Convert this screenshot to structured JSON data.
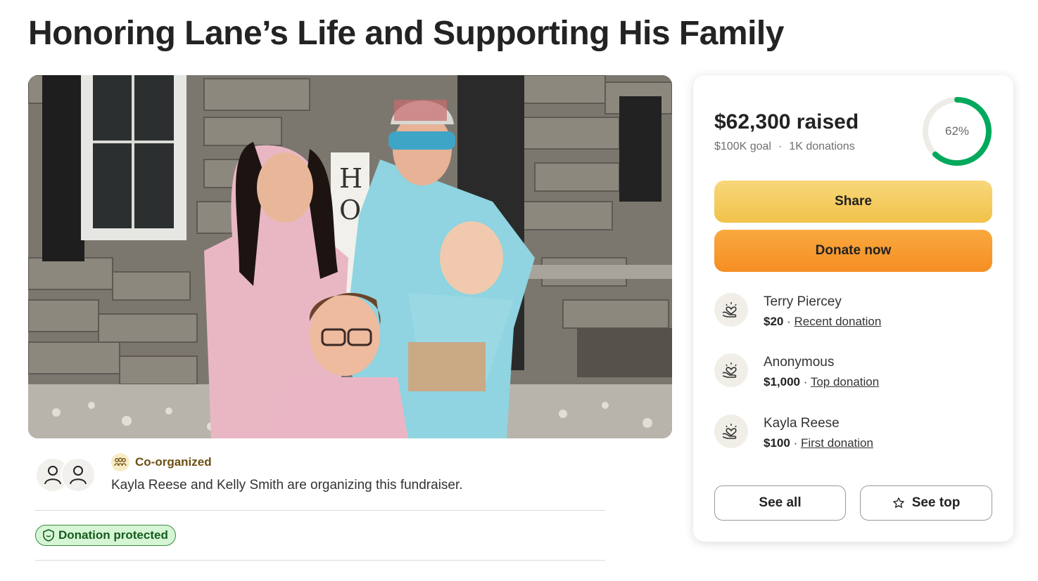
{
  "page": {
    "title": "Honoring Lane’s Life and Supporting His Family"
  },
  "organizer": {
    "badge_label": "Co-organized",
    "text": "Kayla Reese and Kelly Smith are organizing this fundraiser."
  },
  "protection": {
    "label": "Donation protected"
  },
  "campaign": {
    "raised": "$62,300 raised",
    "goal": "$100K goal",
    "separator": "·",
    "donations_count": "1K donations",
    "progress_label": "62%",
    "progress_fraction": 0.62,
    "progress_color": "#02a95c"
  },
  "actions": {
    "share_label": "Share",
    "donate_label": "Donate now",
    "see_all_label": "See all",
    "see_top_label": "See top"
  },
  "donations": [
    {
      "name": "Terry Piercey",
      "amount": "$20",
      "separator": "·",
      "type": "Recent donation",
      "icon": "heart-hands-icon"
    },
    {
      "name": "Anonymous",
      "amount": "$1,000",
      "separator": "·",
      "type": "Top donation",
      "icon": "heart-hands-icon"
    },
    {
      "name": "Kayla Reese",
      "amount": "$100",
      "separator": "·",
      "type": "First donation",
      "icon": "heart-hands-icon"
    }
  ],
  "colors": {
    "share_button": "#f3c95a",
    "donate_button": "#f79a2e",
    "protected_badge_bg": "#d6f5d5",
    "protected_badge_text": "#155d1d",
    "coorganized_text": "#6b4f12"
  }
}
